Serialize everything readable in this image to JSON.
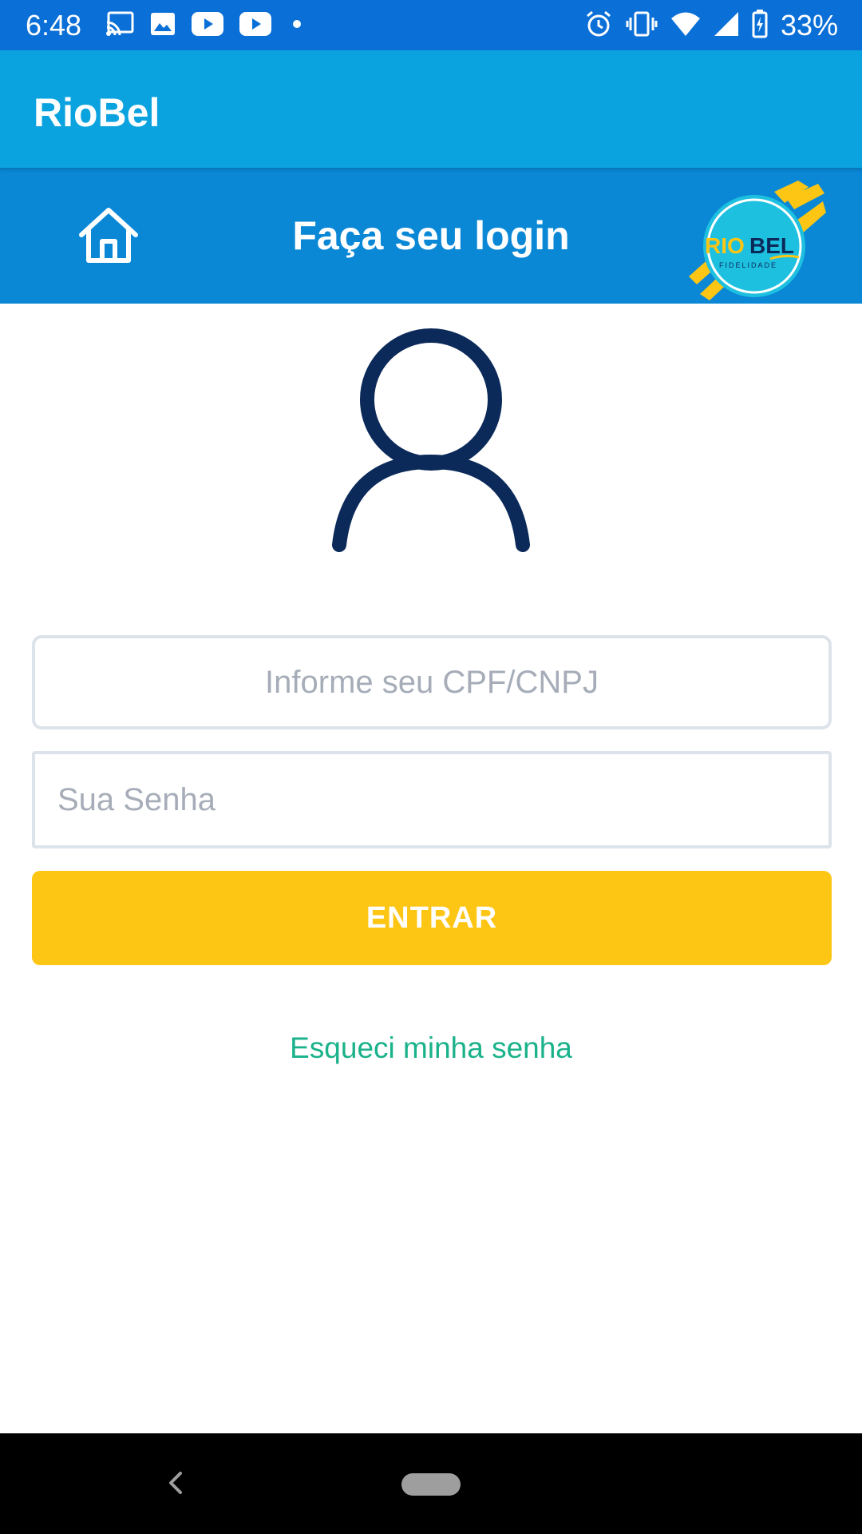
{
  "status_bar": {
    "time": "6:48",
    "battery": "33%",
    "left_icons": [
      "cast-icon",
      "image-icon",
      "youtube-icon",
      "youtube-icon",
      "dot-icon"
    ],
    "right_icons": [
      "alarm-icon",
      "vibrate-icon",
      "wifi-icon",
      "signal-icon",
      "battery-charging-icon"
    ]
  },
  "app_bar": {
    "title": "RioBel"
  },
  "header": {
    "title": "Faça seu login",
    "home_icon": "home-icon",
    "logo": {
      "text_rio": "RIO",
      "text_bel": "BEL",
      "subtitle": "FIDELIDADE"
    }
  },
  "form": {
    "cpf_placeholder": "Informe seu CPF/CNPJ",
    "cpf_value": "",
    "password_placeholder": "Sua Senha",
    "password_value": "",
    "submit_label": "ENTRAR",
    "forgot_label": "Esqueci minha senha"
  },
  "colors": {
    "status_bar": "#0a6fd6",
    "app_bar": "#0aa3df",
    "header": "#0a88d6",
    "button": "#fdc514",
    "link": "#1ab28a",
    "avatar": "#0b2a5a"
  }
}
